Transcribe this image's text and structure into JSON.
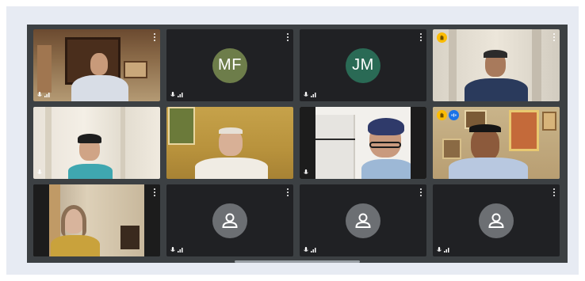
{
  "meeting": {
    "tiles": [
      {
        "id": "p1",
        "type": "video"
      },
      {
        "id": "p2",
        "type": "initials",
        "initials": "MF",
        "color": "#6d7d4a"
      },
      {
        "id": "p3",
        "type": "initials",
        "initials": "JM",
        "color": "#2a6a55"
      },
      {
        "id": "p4",
        "type": "video",
        "hand_raised": true
      },
      {
        "id": "p5",
        "type": "video"
      },
      {
        "id": "p6",
        "type": "video"
      },
      {
        "id": "p7",
        "type": "video"
      },
      {
        "id": "p8",
        "type": "video",
        "hand_raised": true,
        "speaking": true
      },
      {
        "id": "p9",
        "type": "video"
      },
      {
        "id": "p10",
        "type": "avatar"
      },
      {
        "id": "p11",
        "type": "avatar"
      },
      {
        "id": "p12",
        "type": "avatar"
      }
    ],
    "icons": {
      "tile_menu": "more-vert-icon",
      "mic": "mic-icon",
      "signal": "signal-icon",
      "hand": "raised-hand-icon",
      "avatar": "person-icon"
    },
    "colors": {
      "tile_bg": "#202124",
      "grid_bg": "#3c4043",
      "panel_bg": "#e7ebf3",
      "speaking_outline": "#8ab4f8",
      "hand_badge": "#fbbc04",
      "avatar_bg": "#6c6f73"
    }
  }
}
